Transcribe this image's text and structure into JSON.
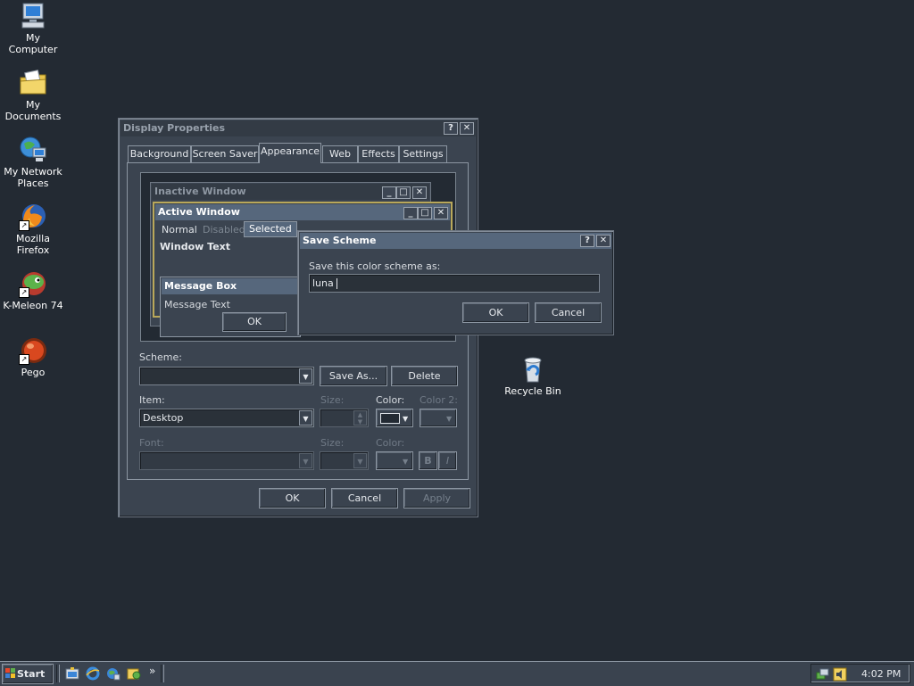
{
  "desktop": {
    "icons": [
      {
        "label_line1": "My Computer",
        "label_line2": "",
        "icon": "computer-icon"
      },
      {
        "label_line1": "My Documents",
        "label_line2": "",
        "icon": "folder-documents-icon"
      },
      {
        "label_line1": "My Network",
        "label_line2": "Places",
        "icon": "network-places-icon"
      },
      {
        "label_line1": "Mozilla Firefox",
        "label_line2": "",
        "icon": "firefox-icon"
      },
      {
        "label_line1": "K-Meleon 74",
        "label_line2": "",
        "icon": "kmeleon-icon"
      },
      {
        "label_line1": "Pego",
        "label_line2": "",
        "icon": "pego-icon"
      }
    ],
    "recycle_bin": {
      "label": "Recycle Bin",
      "icon": "recycle-bin-icon"
    }
  },
  "display_properties": {
    "title": "Display Properties",
    "help_glyph": "?",
    "close_glyph": "✕",
    "tabs": [
      "Background",
      "Screen Saver",
      "Appearance",
      "Web",
      "Effects",
      "Settings"
    ],
    "active_tab": "Appearance",
    "preview": {
      "inactive_title": "Inactive Window",
      "active_title": "Active Window",
      "menu_normal": "Normal",
      "menu_disabled": "Disabled",
      "menu_selected": "Selected",
      "window_text": "Window Text",
      "message_box_title": "Message Box",
      "message_text": "Message Text",
      "ok": "OK"
    },
    "scheme_label": "Scheme:",
    "scheme_value": "",
    "save_as": "Save As...",
    "delete": "Delete",
    "item_label": "Item:",
    "item_value": "Desktop",
    "size_label": "Size:",
    "color_label": "Color:",
    "color2_label": "Color 2:",
    "font_label": "Font:",
    "font_size_label": "Size:",
    "font_color_label": "Color:",
    "bold_glyph": "B",
    "italic_glyph": "I",
    "desktop_color": "#232a33",
    "ok": "OK",
    "cancel": "Cancel",
    "apply": "Apply"
  },
  "save_scheme": {
    "title": "Save Scheme",
    "prompt": "Save this color scheme as:",
    "input_value": "luna",
    "ok": "OK",
    "cancel": "Cancel"
  },
  "taskbar": {
    "start_label": "Start",
    "quick_launch": [
      "show-desktop-icon",
      "internet-explorer-icon",
      "windows-explorer-icon",
      "media-icon"
    ],
    "chevron": "»",
    "tray_icons": [
      "network-tray-icon",
      "volume-tray-icon"
    ],
    "clock": "4:02 PM"
  },
  "colors": {
    "desktop": "#232a33",
    "window_face": "#3b4450",
    "active_title": "#56677c",
    "inactive_title": "#333b45"
  }
}
